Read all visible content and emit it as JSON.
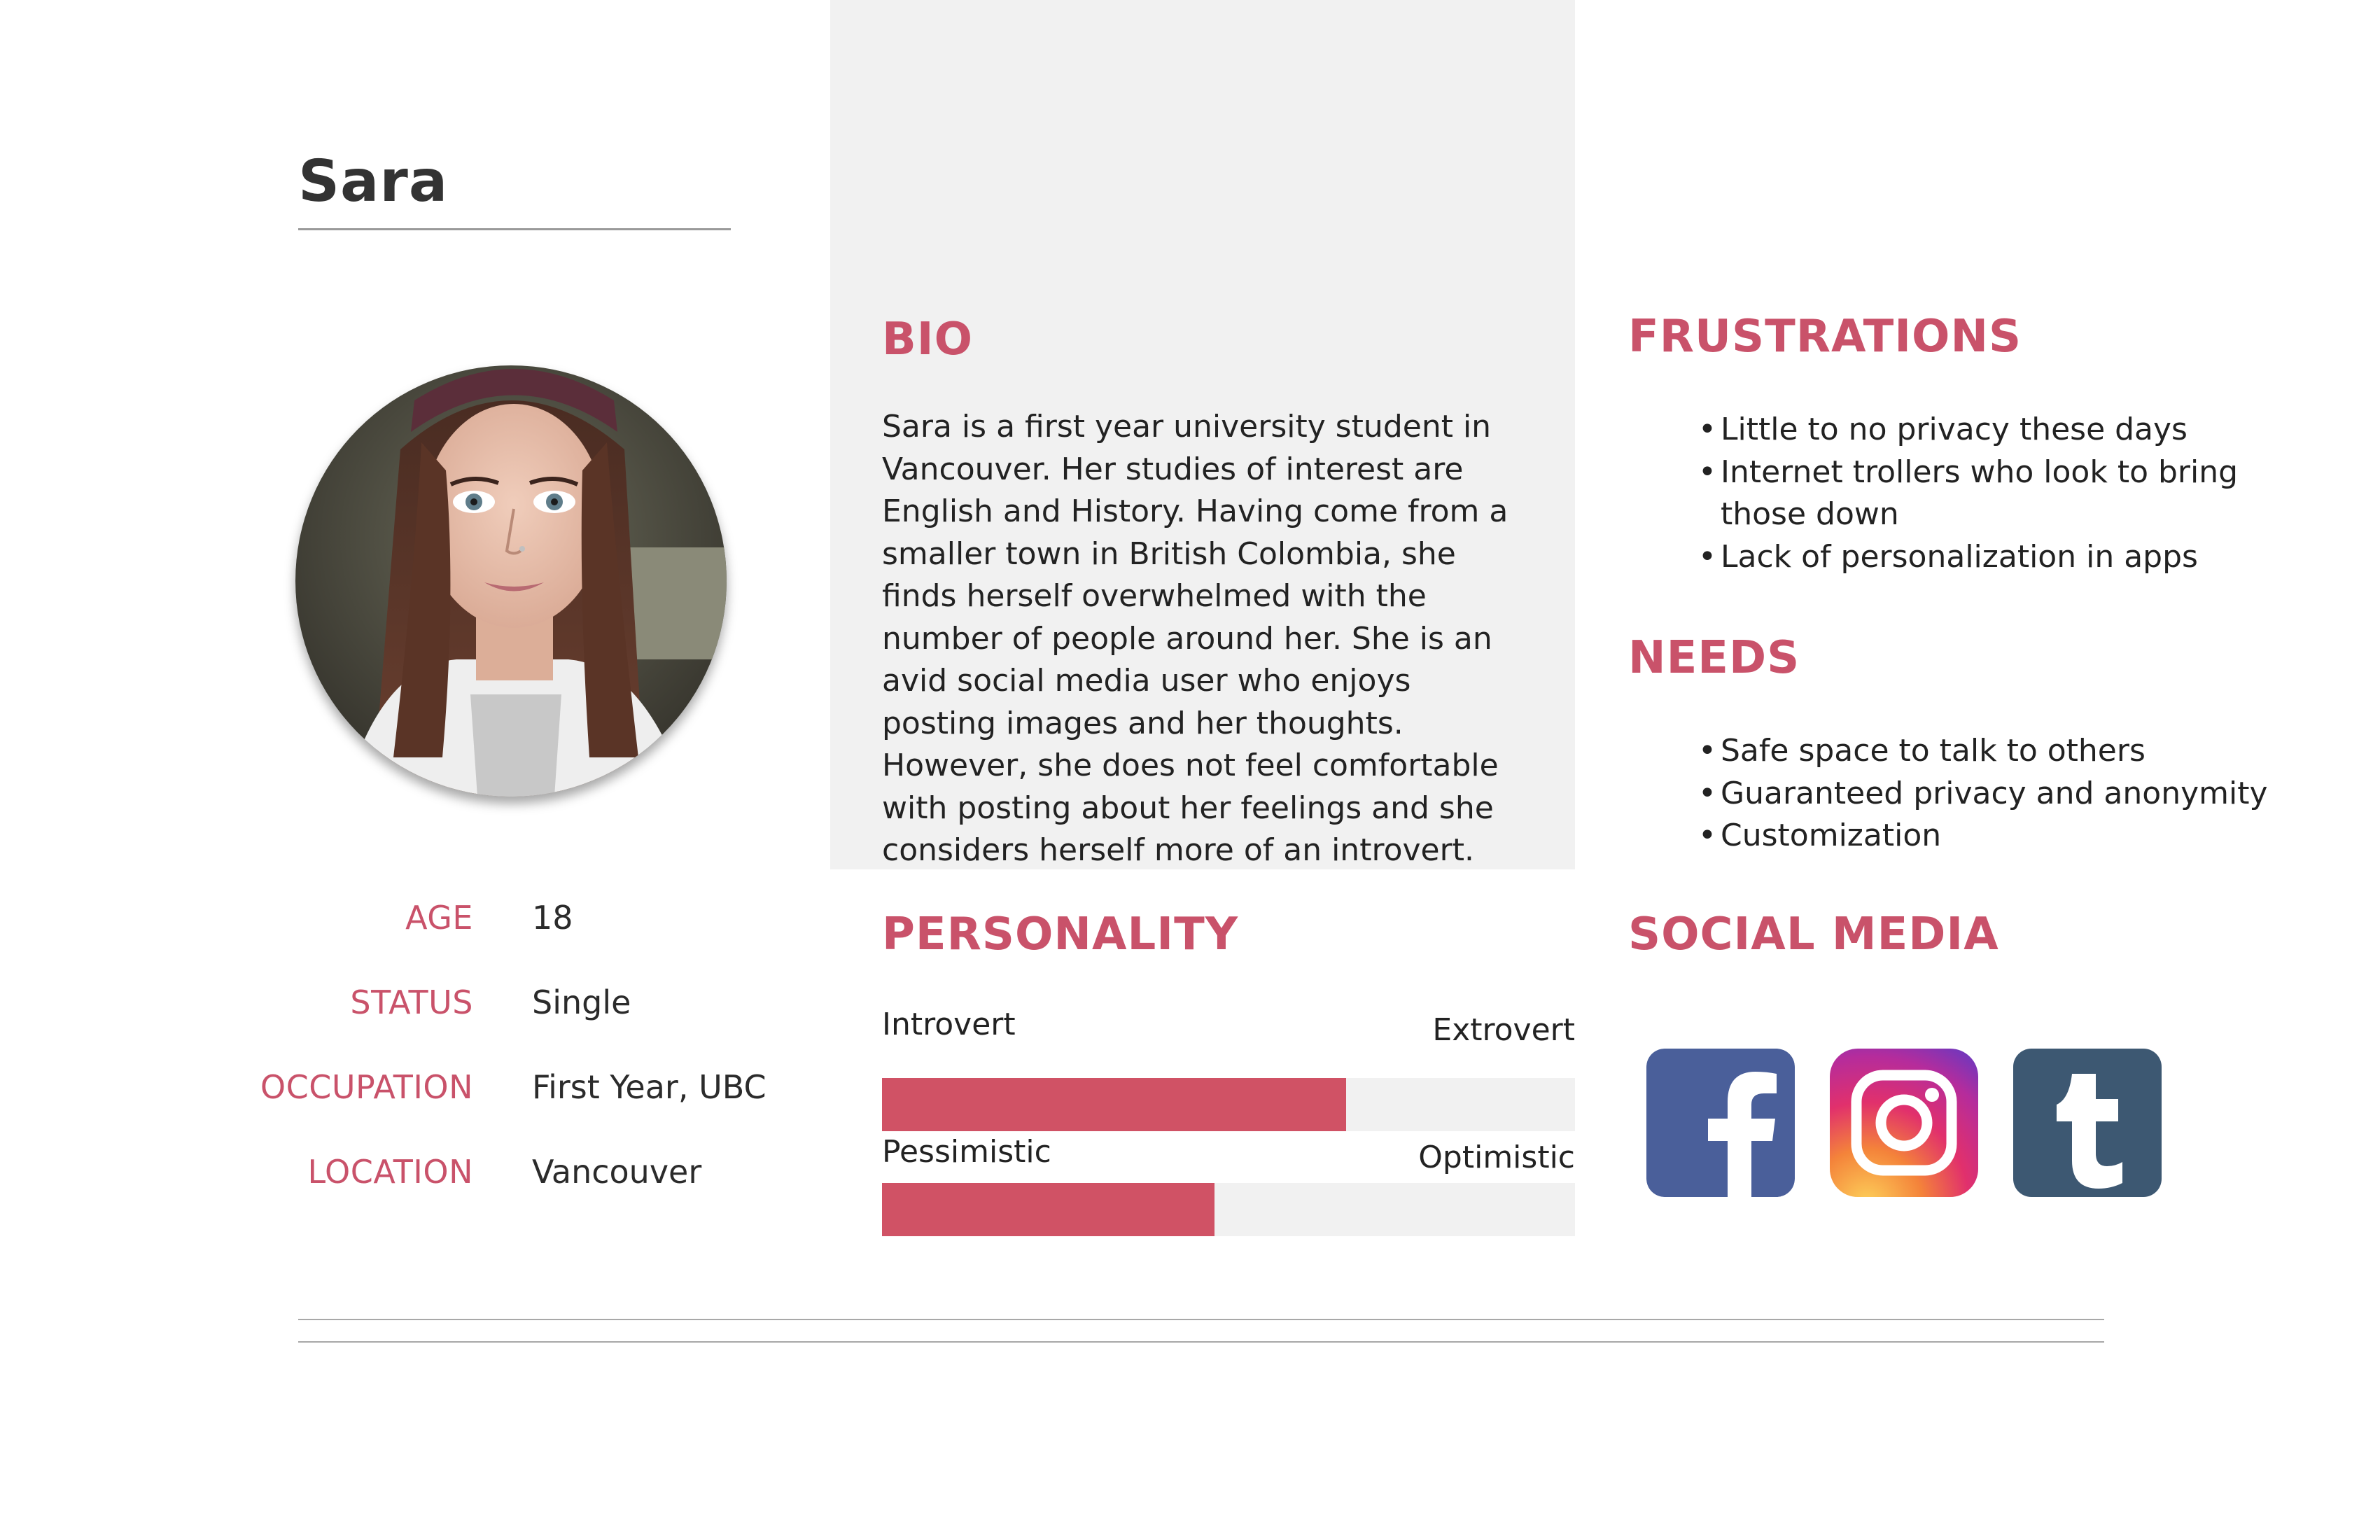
{
  "persona": {
    "name": "Sara"
  },
  "details": [
    {
      "label": "AGE",
      "value": "18"
    },
    {
      "label": "STATUS",
      "value": "Single"
    },
    {
      "label": "OCCUPATION",
      "value": "First Year, UBC"
    },
    {
      "label": "LOCATION",
      "value": "Vancouver"
    }
  ],
  "bio": {
    "heading": "BIO",
    "text": "Sara is a first year university student in Vancouver. Her studies of interest are English and History. Having come from a smaller town in British Colombia, she finds herself overwhelmed with the number of people around her. She is an avid social media user who enjoys posting images and her thoughts. However, she does not feel comfortable with posting about her feelings and she considers herself more of an introvert."
  },
  "frustrations": {
    "heading": "FRUSTRATIONS",
    "items": [
      "Little to no privacy these days",
      "Internet trollers who look to bring those down",
      "Lack of personalization in apps"
    ]
  },
  "needs": {
    "heading": "NEEDS",
    "items": [
      "Safe space to talk to others",
      "Guaranteed privacy and anonymity",
      "Customization"
    ]
  },
  "personality": {
    "heading": "PERSONALITY",
    "traits": [
      {
        "left": "Introvert",
        "right": "Extrovert",
        "level": 0.67
      },
      {
        "left": "Pessimistic",
        "right": "Optimistic",
        "level": 0.48
      }
    ]
  },
  "social_media": {
    "heading": "SOCIAL MEDIA",
    "icons": [
      "facebook-icon",
      "instagram-icon",
      "tumblr-icon"
    ]
  },
  "colors": {
    "accent": "#c9526a",
    "bar_fill": "#d05265",
    "panel_bg": "#f1f1f1",
    "facebook": "#4a5f9a",
    "tumblr": "#3d5872"
  }
}
